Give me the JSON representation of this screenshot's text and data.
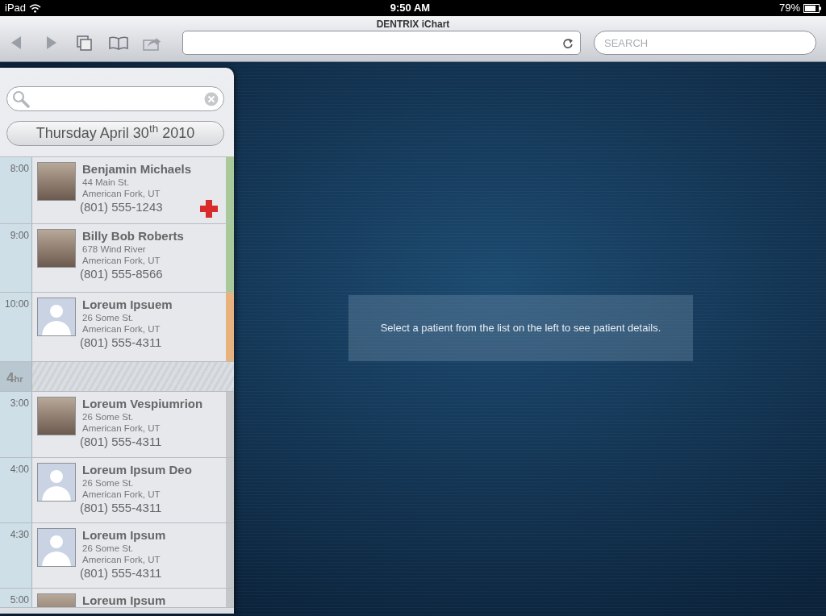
{
  "status_bar": {
    "device": "iPad",
    "time": "9:50 AM",
    "battery": "79%"
  },
  "browser": {
    "title": "DENTRIX iChart",
    "search": {
      "placeholder": "SEARCH"
    }
  },
  "sidebar": {
    "date": "Thursday April 30$^{th}$ 2010",
    "schedule": [
      {
        "kind": "appointment",
        "time": "8:00",
        "name": "Benjamin Michaels",
        "street": "44 Main St.",
        "city": "American Fork, UT",
        "phone": "(801) 555-1243",
        "photo": true,
        "color": "#a9c99a",
        "alert": true
      },
      {
        "kind": "appointment",
        "time": "9:00",
        "name": "Billy Bob Roberts",
        "street": "678 Wind River",
        "city": "American Fork, UT",
        "phone": "(801) 555-8566",
        "photo": true,
        "color": "#a9c99a",
        "alert": false
      },
      {
        "kind": "appointment",
        "time": "10:00",
        "name": "Loreum Ipsuem",
        "street": "26 Some St.",
        "city": "American Fork, UT",
        "phone": "(801) 555-4311",
        "photo": false,
        "color": "#e8b27f",
        "alert": false
      },
      {
        "kind": "gap",
        "value": "4",
        "unit": "hr"
      },
      {
        "kind": "appointment",
        "time": "3:00",
        "name": "Loreum Vespiumrion",
        "street": "26 Some St.",
        "city": "American Fork, UT",
        "phone": "(801) 555-4311",
        "photo": true,
        "color": "#c4c6ca",
        "alert": false
      },
      {
        "kind": "appointment",
        "time": "4:00",
        "name": "Loreum Ipsum Deo",
        "street": "26 Some St.",
        "city": "American Fork, UT",
        "phone": "(801) 555-4311",
        "photo": false,
        "color": "#c4c6ca",
        "alert": false
      },
      {
        "kind": "appointment",
        "time": "4:30",
        "name": "Loreum Ipsum",
        "street": "26 Some St.",
        "city": "American Fork, UT",
        "phone": "(801) 555-4311",
        "photo": false,
        "color": "#c4c6ca",
        "alert": false
      },
      {
        "kind": "partial",
        "time": "5:00",
        "name": "Loreum Ipsum",
        "photo": true,
        "color": "#c4c6ca"
      }
    ]
  },
  "detail": {
    "message": "Select a patient from the list on the left to see patient details."
  }
}
